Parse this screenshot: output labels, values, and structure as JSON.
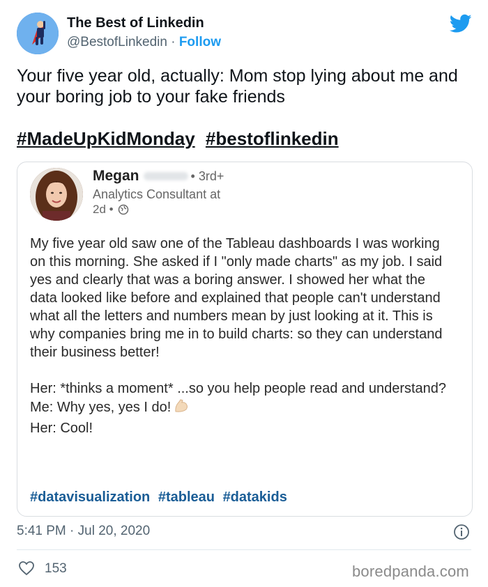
{
  "author": {
    "name": "The Best of Linkedin",
    "handle": "@BestofLinkedin",
    "separator": " · ",
    "follow_label": "Follow",
    "avatar_icon": "superhero-avatar"
  },
  "brand_icon": "twitter-bird-icon",
  "tweet": {
    "text": "Your five year old, actually: Mom stop lying about me and your boring job to your fake friends",
    "hashtags": [
      "#MadeUpKidMonday",
      "#bestoflinkedin"
    ]
  },
  "embed": {
    "name": "Megan",
    "degree": "• 3rd+",
    "title": "Analytics Consultant at",
    "time": "2d •",
    "time_icon": "globe-icon",
    "body": "My five year old saw one of the Tableau dashboards I was working on this morning.  She asked if I \"only made charts\" as my job.  I said yes and clearly that was a boring answer. I showed her what the data looked like before and explained that people can't understand what all the letters and numbers mean by just looking at it. This is why companies bring me in to build charts: so they can understand their business better!\n\nHer: *thinks a moment* ...so you help people read and understand?\nMe: Why yes, yes I do!",
    "body_tail": "Her: Cool!",
    "emoji": "flexed-biceps-emoji",
    "tags": [
      "#datavisualization",
      "#tableau",
      "#datakids"
    ]
  },
  "footer": {
    "timestamp": "5:41 PM · Jul 20, 2020",
    "info_icon": "info-icon",
    "like_icon": "heart-icon",
    "like_count": "153",
    "watermark": "boredpanda.com"
  },
  "colors": {
    "accent": "#1d9bf0",
    "linkedin_link": "#1a5d96",
    "text": "#0f1419",
    "muted": "#536471"
  }
}
